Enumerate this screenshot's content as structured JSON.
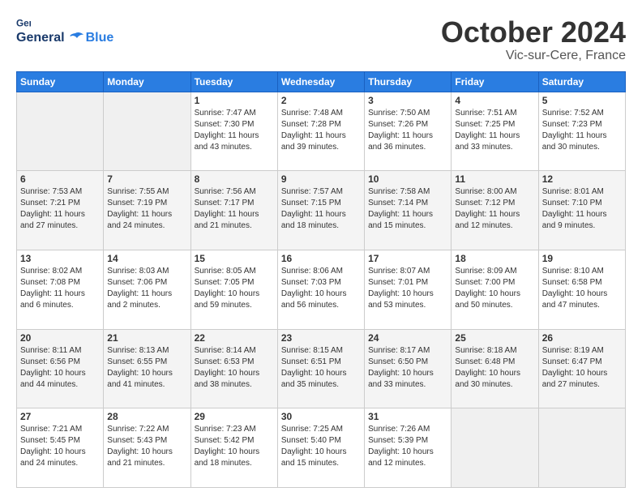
{
  "logo": {
    "line1": "General",
    "line2": "Blue"
  },
  "header": {
    "title": "October 2024",
    "subtitle": "Vic-sur-Cere, France"
  },
  "weekdays": [
    "Sunday",
    "Monday",
    "Tuesday",
    "Wednesday",
    "Thursday",
    "Friday",
    "Saturday"
  ],
  "weeks": [
    [
      {
        "day": "",
        "info": ""
      },
      {
        "day": "",
        "info": ""
      },
      {
        "day": "1",
        "info": "Sunrise: 7:47 AM\nSunset: 7:30 PM\nDaylight: 11 hours and 43 minutes."
      },
      {
        "day": "2",
        "info": "Sunrise: 7:48 AM\nSunset: 7:28 PM\nDaylight: 11 hours and 39 minutes."
      },
      {
        "day": "3",
        "info": "Sunrise: 7:50 AM\nSunset: 7:26 PM\nDaylight: 11 hours and 36 minutes."
      },
      {
        "day": "4",
        "info": "Sunrise: 7:51 AM\nSunset: 7:25 PM\nDaylight: 11 hours and 33 minutes."
      },
      {
        "day": "5",
        "info": "Sunrise: 7:52 AM\nSunset: 7:23 PM\nDaylight: 11 hours and 30 minutes."
      }
    ],
    [
      {
        "day": "6",
        "info": "Sunrise: 7:53 AM\nSunset: 7:21 PM\nDaylight: 11 hours and 27 minutes."
      },
      {
        "day": "7",
        "info": "Sunrise: 7:55 AM\nSunset: 7:19 PM\nDaylight: 11 hours and 24 minutes."
      },
      {
        "day": "8",
        "info": "Sunrise: 7:56 AM\nSunset: 7:17 PM\nDaylight: 11 hours and 21 minutes."
      },
      {
        "day": "9",
        "info": "Sunrise: 7:57 AM\nSunset: 7:15 PM\nDaylight: 11 hours and 18 minutes."
      },
      {
        "day": "10",
        "info": "Sunrise: 7:58 AM\nSunset: 7:14 PM\nDaylight: 11 hours and 15 minutes."
      },
      {
        "day": "11",
        "info": "Sunrise: 8:00 AM\nSunset: 7:12 PM\nDaylight: 11 hours and 12 minutes."
      },
      {
        "day": "12",
        "info": "Sunrise: 8:01 AM\nSunset: 7:10 PM\nDaylight: 11 hours and 9 minutes."
      }
    ],
    [
      {
        "day": "13",
        "info": "Sunrise: 8:02 AM\nSunset: 7:08 PM\nDaylight: 11 hours and 6 minutes."
      },
      {
        "day": "14",
        "info": "Sunrise: 8:03 AM\nSunset: 7:06 PM\nDaylight: 11 hours and 2 minutes."
      },
      {
        "day": "15",
        "info": "Sunrise: 8:05 AM\nSunset: 7:05 PM\nDaylight: 10 hours and 59 minutes."
      },
      {
        "day": "16",
        "info": "Sunrise: 8:06 AM\nSunset: 7:03 PM\nDaylight: 10 hours and 56 minutes."
      },
      {
        "day": "17",
        "info": "Sunrise: 8:07 AM\nSunset: 7:01 PM\nDaylight: 10 hours and 53 minutes."
      },
      {
        "day": "18",
        "info": "Sunrise: 8:09 AM\nSunset: 7:00 PM\nDaylight: 10 hours and 50 minutes."
      },
      {
        "day": "19",
        "info": "Sunrise: 8:10 AM\nSunset: 6:58 PM\nDaylight: 10 hours and 47 minutes."
      }
    ],
    [
      {
        "day": "20",
        "info": "Sunrise: 8:11 AM\nSunset: 6:56 PM\nDaylight: 10 hours and 44 minutes."
      },
      {
        "day": "21",
        "info": "Sunrise: 8:13 AM\nSunset: 6:55 PM\nDaylight: 10 hours and 41 minutes."
      },
      {
        "day": "22",
        "info": "Sunrise: 8:14 AM\nSunset: 6:53 PM\nDaylight: 10 hours and 38 minutes."
      },
      {
        "day": "23",
        "info": "Sunrise: 8:15 AM\nSunset: 6:51 PM\nDaylight: 10 hours and 35 minutes."
      },
      {
        "day": "24",
        "info": "Sunrise: 8:17 AM\nSunset: 6:50 PM\nDaylight: 10 hours and 33 minutes."
      },
      {
        "day": "25",
        "info": "Sunrise: 8:18 AM\nSunset: 6:48 PM\nDaylight: 10 hours and 30 minutes."
      },
      {
        "day": "26",
        "info": "Sunrise: 8:19 AM\nSunset: 6:47 PM\nDaylight: 10 hours and 27 minutes."
      }
    ],
    [
      {
        "day": "27",
        "info": "Sunrise: 7:21 AM\nSunset: 5:45 PM\nDaylight: 10 hours and 24 minutes."
      },
      {
        "day": "28",
        "info": "Sunrise: 7:22 AM\nSunset: 5:43 PM\nDaylight: 10 hours and 21 minutes."
      },
      {
        "day": "29",
        "info": "Sunrise: 7:23 AM\nSunset: 5:42 PM\nDaylight: 10 hours and 18 minutes."
      },
      {
        "day": "30",
        "info": "Sunrise: 7:25 AM\nSunset: 5:40 PM\nDaylight: 10 hours and 15 minutes."
      },
      {
        "day": "31",
        "info": "Sunrise: 7:26 AM\nSunset: 5:39 PM\nDaylight: 10 hours and 12 minutes."
      },
      {
        "day": "",
        "info": ""
      },
      {
        "day": "",
        "info": ""
      }
    ]
  ]
}
